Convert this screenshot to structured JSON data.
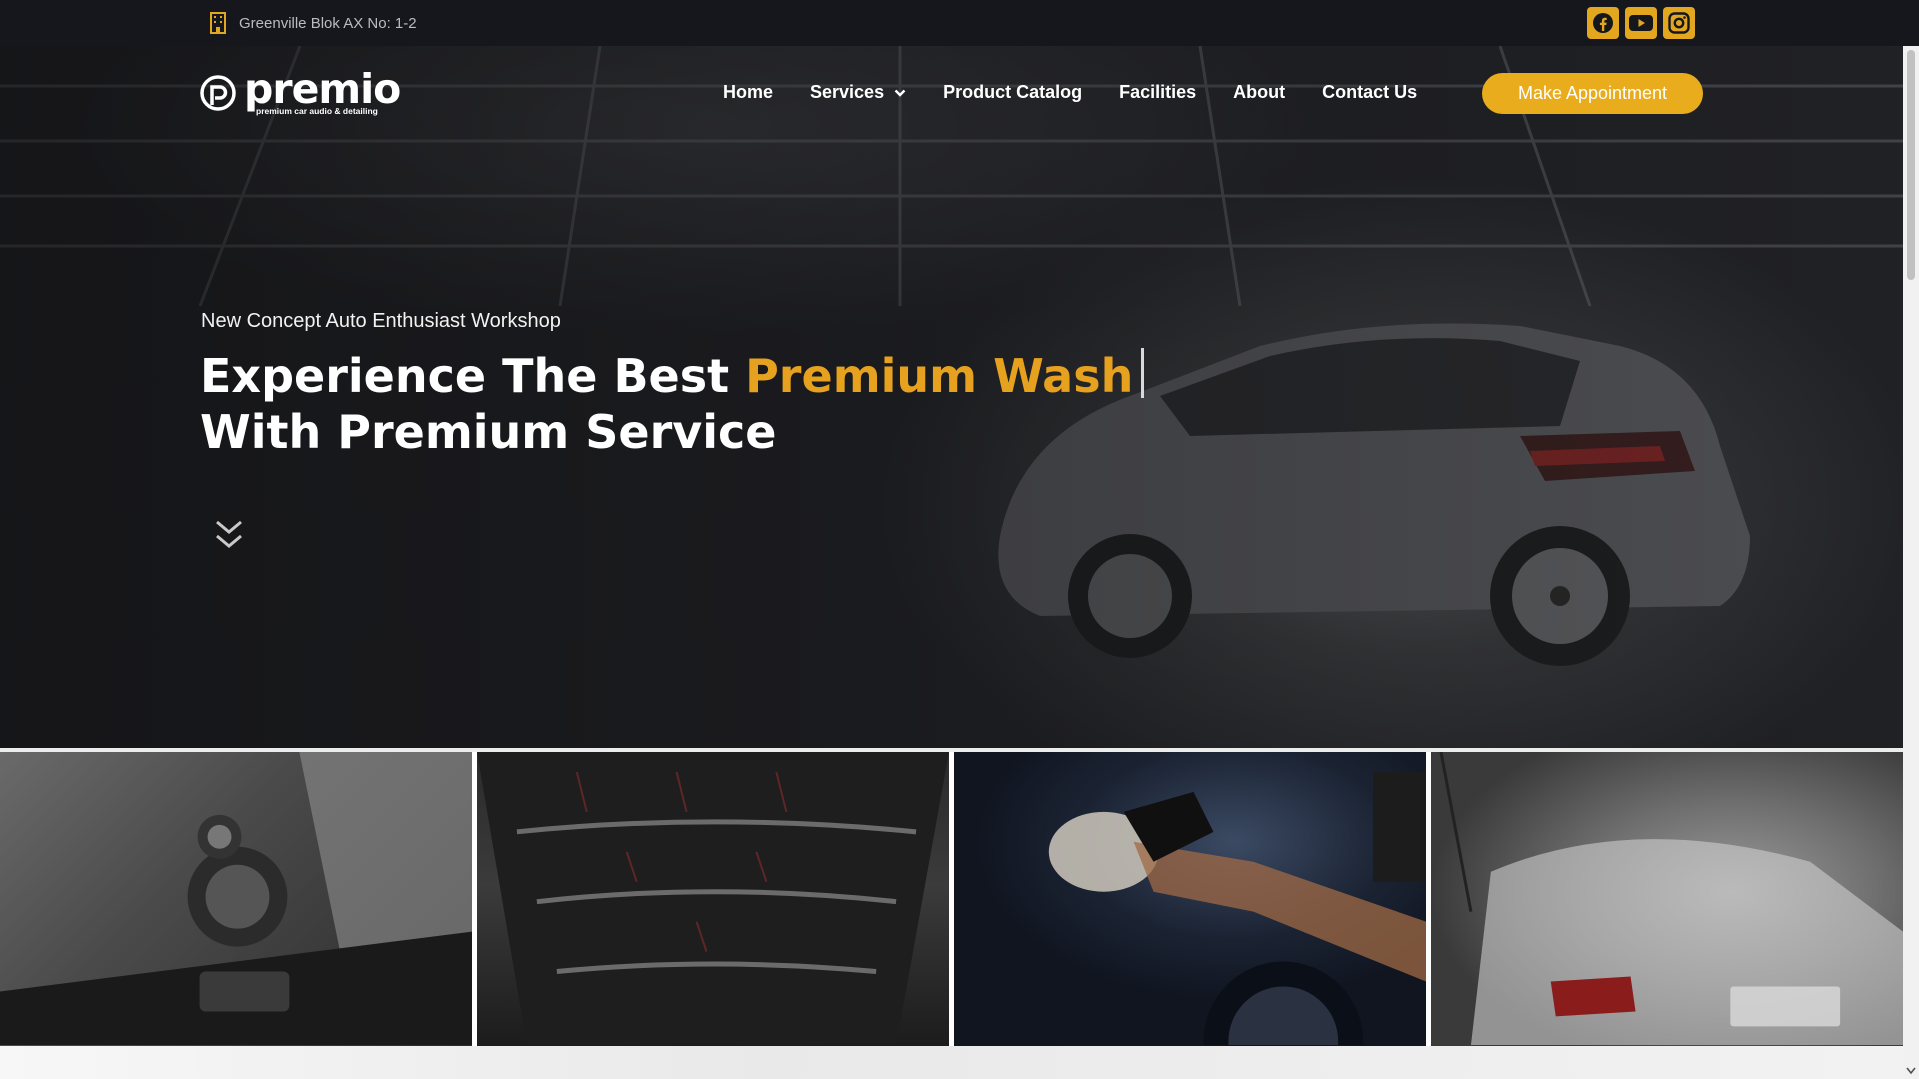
{
  "topbar": {
    "address": "Greenville Blok AX No: 1-2",
    "address_icon": "building-icon",
    "socials": [
      {
        "name": "facebook-icon"
      },
      {
        "name": "youtube-icon"
      },
      {
        "name": "instagram-icon"
      }
    ],
    "social_color": "#e3a71f"
  },
  "logo": {
    "name": "premio",
    "tagline": "premium car audio & detailing"
  },
  "nav": {
    "items": [
      {
        "label": "Home"
      },
      {
        "label": "Services",
        "dropdown": true
      },
      {
        "label": "Product Catalog"
      },
      {
        "label": "Facilities"
      },
      {
        "label": "About"
      },
      {
        "label": "Contact Us"
      }
    ],
    "cta_label": "Make Appointment"
  },
  "hero": {
    "kicker": "New Concept Auto Enthusiast Workshop",
    "headline_part1": "Experience The Best ",
    "headline_accent": "Premium Wash",
    "headline_part2": "With Premium Service",
    "accent_color": "#e6a21f",
    "scroll_icon": "double-chevron-down-icon"
  },
  "gallery": {
    "tiles": [
      {
        "name": "car-audio-speaker-photo"
      },
      {
        "name": "sound-damping-roof-photo"
      },
      {
        "name": "car-polishing-photo"
      },
      {
        "name": "car-foam-wash-photo"
      }
    ]
  }
}
